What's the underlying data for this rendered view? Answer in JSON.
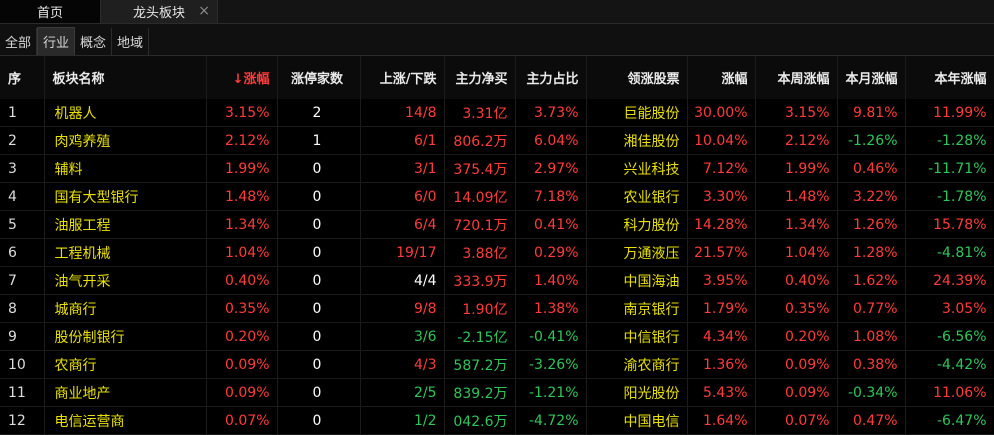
{
  "tabs": {
    "home": "首页",
    "active": "龙头板块",
    "close": "×"
  },
  "subtabs": [
    "全部",
    "行业",
    "概念",
    "地域"
  ],
  "columns": [
    "序",
    "板块名称",
    "涨幅",
    "涨停家数",
    "上涨/下跌",
    "主力净买",
    "主力占比",
    "领涨股票",
    "涨幅",
    "本周涨幅",
    "本月涨幅",
    "本年涨幅"
  ],
  "sort_glyph": "↓",
  "colors": {
    "up": "#ff3b3b",
    "down": "#2ec65a",
    "neutral": "#ffffff",
    "name": "#e8e000"
  },
  "rows": [
    {
      "idx": "1",
      "name": "机器人",
      "chg": "3.15%",
      "limit": "2",
      "updown": "14/8",
      "net": "3.31亿",
      "ratio": "3.73%",
      "lead": "巨能股份",
      "lchg": "30.00%",
      "week": "3.15%",
      "month": "9.81%",
      "year": "11.99%",
      "c": {
        "chg": "red",
        "limit": "white",
        "updown": "red",
        "net": "red",
        "ratio": "red",
        "lchg": "red",
        "week": "red",
        "month": "red",
        "year": "red"
      }
    },
    {
      "idx": "2",
      "name": "肉鸡养殖",
      "chg": "2.12%",
      "limit": "1",
      "updown": "6/1",
      "net": "806.2万",
      "ratio": "6.04%",
      "lead": "湘佳股份",
      "lchg": "10.04%",
      "week": "2.12%",
      "month": "-1.26%",
      "year": "-1.28%",
      "c": {
        "chg": "red",
        "limit": "white",
        "updown": "red",
        "net": "red",
        "ratio": "red",
        "lchg": "red",
        "week": "red",
        "month": "green",
        "year": "green"
      }
    },
    {
      "idx": "3",
      "name": "辅料",
      "chg": "1.99%",
      "limit": "0",
      "updown": "3/1",
      "net": "375.4万",
      "ratio": "2.97%",
      "lead": "兴业科技",
      "lchg": "7.12%",
      "week": "1.99%",
      "month": "0.46%",
      "year": "-11.71%",
      "c": {
        "chg": "red",
        "limit": "white",
        "updown": "red",
        "net": "red",
        "ratio": "red",
        "lchg": "red",
        "week": "red",
        "month": "red",
        "year": "green"
      }
    },
    {
      "idx": "4",
      "name": "国有大型银行",
      "chg": "1.48%",
      "limit": "0",
      "updown": "6/0",
      "net": "14.09亿",
      "ratio": "7.18%",
      "lead": "农业银行",
      "lchg": "3.30%",
      "week": "1.48%",
      "month": "3.22%",
      "year": "-1.78%",
      "c": {
        "chg": "red",
        "limit": "white",
        "updown": "red",
        "net": "red",
        "ratio": "red",
        "lchg": "red",
        "week": "red",
        "month": "red",
        "year": "green"
      }
    },
    {
      "idx": "5",
      "name": "油服工程",
      "chg": "1.34%",
      "limit": "0",
      "updown": "6/4",
      "net": "720.1万",
      "ratio": "0.41%",
      "lead": "科力股份",
      "lchg": "14.28%",
      "week": "1.34%",
      "month": "1.26%",
      "year": "15.78%",
      "c": {
        "chg": "red",
        "limit": "white",
        "updown": "red",
        "net": "red",
        "ratio": "red",
        "lchg": "red",
        "week": "red",
        "month": "red",
        "year": "red"
      }
    },
    {
      "idx": "6",
      "name": "工程机械",
      "chg": "1.04%",
      "limit": "0",
      "updown": "19/17",
      "net": "3.88亿",
      "ratio": "0.29%",
      "lead": "万通液压",
      "lchg": "21.57%",
      "week": "1.04%",
      "month": "1.28%",
      "year": "-4.81%",
      "c": {
        "chg": "red",
        "limit": "white",
        "updown": "red",
        "net": "red",
        "ratio": "red",
        "lchg": "red",
        "week": "red",
        "month": "red",
        "year": "green"
      }
    },
    {
      "idx": "7",
      "name": "油气开采",
      "chg": "0.40%",
      "limit": "0",
      "updown": "4/4",
      "net": "333.9万",
      "ratio": "1.40%",
      "lead": "中国海油",
      "lchg": "3.95%",
      "week": "0.40%",
      "month": "1.62%",
      "year": "24.39%",
      "c": {
        "chg": "red",
        "limit": "white",
        "updown": "white",
        "net": "red",
        "ratio": "red",
        "lchg": "red",
        "week": "red",
        "month": "red",
        "year": "red"
      }
    },
    {
      "idx": "8",
      "name": "城商行",
      "chg": "0.35%",
      "limit": "0",
      "updown": "9/8",
      "net": "1.90亿",
      "ratio": "1.38%",
      "lead": "南京银行",
      "lchg": "1.79%",
      "week": "0.35%",
      "month": "0.77%",
      "year": "3.05%",
      "c": {
        "chg": "red",
        "limit": "white",
        "updown": "red",
        "net": "red",
        "ratio": "red",
        "lchg": "red",
        "week": "red",
        "month": "red",
        "year": "red"
      }
    },
    {
      "idx": "9",
      "name": "股份制银行",
      "chg": "0.20%",
      "limit": "0",
      "updown": "3/6",
      "net": "-2.15亿",
      "ratio": "-0.41%",
      "lead": "中信银行",
      "lchg": "4.34%",
      "week": "0.20%",
      "month": "1.08%",
      "year": "-6.56%",
      "c": {
        "chg": "red",
        "limit": "white",
        "updown": "green",
        "net": "green",
        "ratio": "green",
        "lchg": "red",
        "week": "red",
        "month": "red",
        "year": "green"
      }
    },
    {
      "idx": "10",
      "name": "农商行",
      "chg": "0.09%",
      "limit": "0",
      "updown": "4/3",
      "net": "587.2万",
      "ratio": "-3.26%",
      "lead": "渝农商行",
      "lchg": "1.36%",
      "week": "0.09%",
      "month": "0.38%",
      "year": "-4.42%",
      "c": {
        "chg": "red",
        "limit": "white",
        "updown": "red",
        "net": "green",
        "ratio": "green",
        "lchg": "red",
        "week": "red",
        "month": "red",
        "year": "green"
      }
    },
    {
      "idx": "11",
      "name": "商业地产",
      "chg": "0.09%",
      "limit": "0",
      "updown": "2/5",
      "net": "839.2万",
      "ratio": "-1.21%",
      "lead": "阳光股份",
      "lchg": "5.43%",
      "week": "0.09%",
      "month": "-0.34%",
      "year": "11.06%",
      "c": {
        "chg": "red",
        "limit": "white",
        "updown": "green",
        "net": "green",
        "ratio": "green",
        "lchg": "red",
        "week": "red",
        "month": "green",
        "year": "red"
      }
    },
    {
      "idx": "12",
      "name": "电信运营商",
      "chg": "0.07%",
      "limit": "0",
      "updown": "1/2",
      "net": "042.6万",
      "ratio": "-4.72%",
      "lead": "中国电信",
      "lchg": "1.64%",
      "week": "0.07%",
      "month": "0.47%",
      "year": "-6.47%",
      "c": {
        "chg": "red",
        "limit": "white",
        "updown": "green",
        "net": "green",
        "ratio": "green",
        "lchg": "red",
        "week": "red",
        "month": "red",
        "year": "green"
      }
    }
  ]
}
